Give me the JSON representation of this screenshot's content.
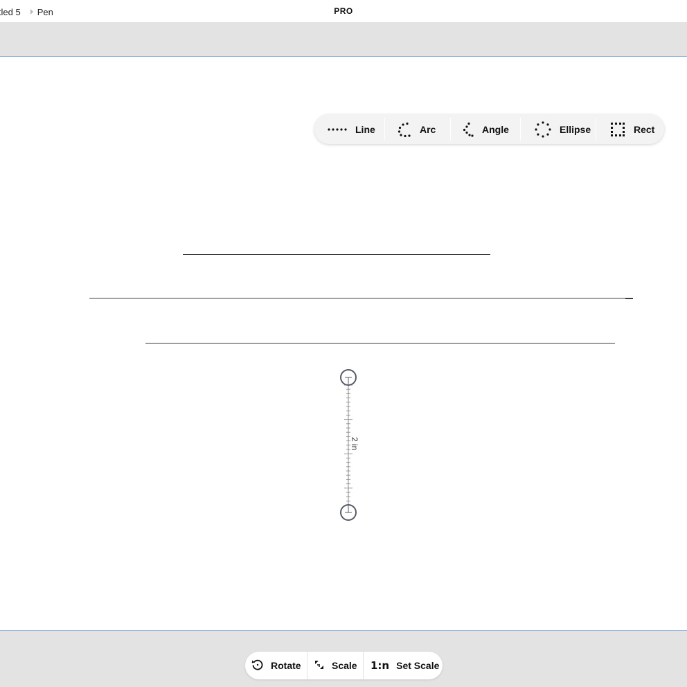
{
  "titlebar": {
    "document_title": "itled 5",
    "tool_name": "Pen",
    "plan_badge": "PRO"
  },
  "shape_tools": [
    {
      "label": "Line",
      "icon": "dotted-line-icon"
    },
    {
      "label": "Arc",
      "icon": "dotted-arc-icon"
    },
    {
      "label": "Angle",
      "icon": "dotted-angle-icon"
    },
    {
      "label": "Ellipse",
      "icon": "dotted-ellipse-icon"
    },
    {
      "label": "Rect",
      "icon": "dotted-rect-icon"
    }
  ],
  "ruler": {
    "measurement_label": "2 in"
  },
  "actions": [
    {
      "label": "Rotate",
      "icon": "rotate-icon"
    },
    {
      "label": "Scale",
      "icon": "scale-icon"
    },
    {
      "label": "Set Scale",
      "icon_text": "1:n"
    }
  ],
  "colors": {
    "toolbar_background": "#e3e3e3",
    "toolbar_border": "#8fb4d6",
    "ink": "#3a3a3a",
    "ruler_handle": "#555b66"
  }
}
